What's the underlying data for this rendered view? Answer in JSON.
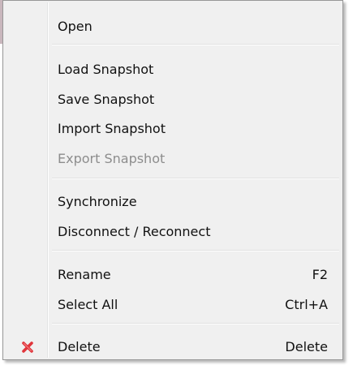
{
  "menu": {
    "items": [
      {
        "label": "Open"
      },
      {
        "label": "Load Snapshot"
      },
      {
        "label": "Save Snapshot"
      },
      {
        "label": "Import Snapshot"
      },
      {
        "label": "Export Snapshot",
        "disabled": true
      },
      {
        "label": "Synchronize"
      },
      {
        "label": "Disconnect / Reconnect"
      },
      {
        "label": "Rename",
        "shortcut": "F2"
      },
      {
        "label": "Select All",
        "shortcut": "Ctrl+A"
      },
      {
        "label": "Delete",
        "shortcut": "Delete",
        "icon": "red-x-icon"
      }
    ]
  },
  "colors": {
    "menu_background": "#f0f0f0",
    "disabled_text": "#8d8d8d",
    "delete_icon": "#e0353b"
  }
}
